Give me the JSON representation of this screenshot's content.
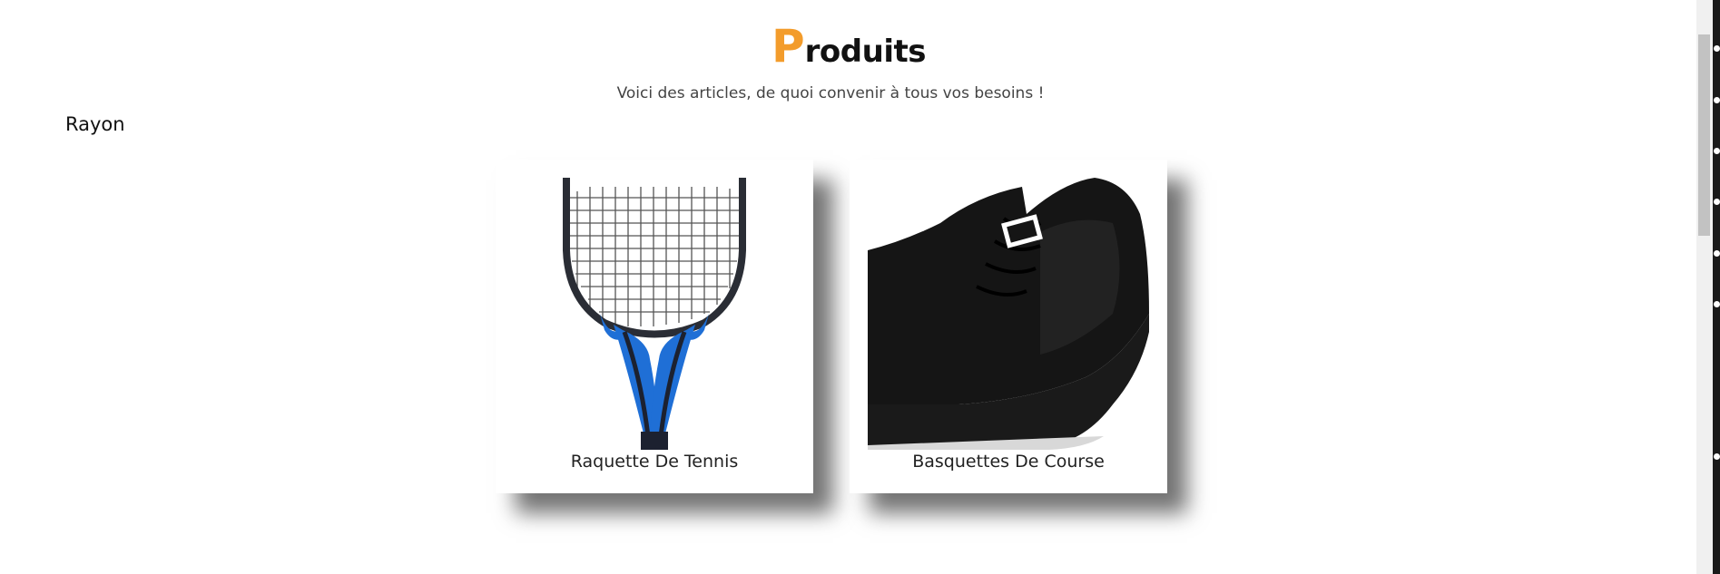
{
  "header": {
    "title_first_letter": "P",
    "title_rest": "roduits",
    "subtitle": "Voici des articles, de quoi convenir à tous vos besoins !"
  },
  "section": {
    "label": "Rayon"
  },
  "products": [
    {
      "name": "Raquette De Tennis",
      "icon": "tennis-racket-image"
    },
    {
      "name": "Basquettes De Course",
      "icon": "running-shoe-image"
    }
  ],
  "colors": {
    "accent": "#f39c2b",
    "racket_frame": "#1f6fd6",
    "shoe": "#151515"
  }
}
